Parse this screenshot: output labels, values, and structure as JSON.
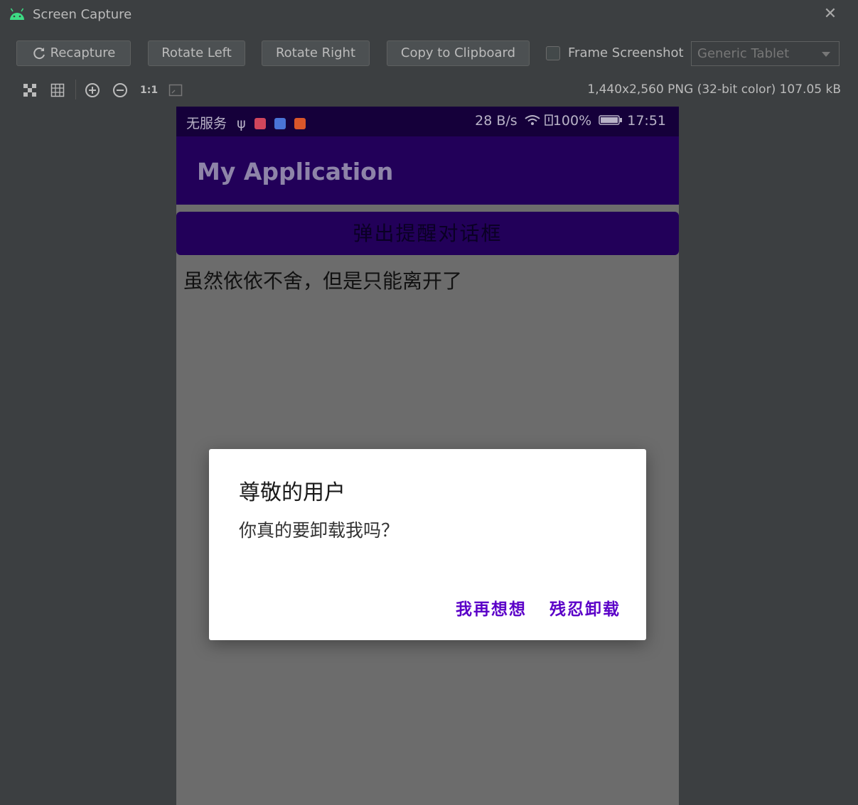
{
  "window": {
    "title": "Screen Capture"
  },
  "toolbar": {
    "recapture": "Recapture",
    "rotate_left": "Rotate Left",
    "rotate_right": "Rotate Right",
    "copy": "Copy to Clipboard",
    "frame_label": "Frame Screenshot",
    "frame_checked": false,
    "device": "Generic Tablet"
  },
  "tools": {
    "actual_size": "1:1"
  },
  "info": "1,440x2,560 PNG (32-bit color) 107.05 kB",
  "phone": {
    "status_left": "无服务",
    "speed": "28 B/s",
    "battery": "100%",
    "time": "17:51",
    "app_title": "My Application",
    "main_button": "弹出提醒对话框",
    "body_text": "虽然依依不舍，但是只能离开了",
    "dialog": {
      "title": "尊敬的用户",
      "message": "你真的要卸载我吗？",
      "negative": "我再想想",
      "positive": "残忍卸载"
    }
  },
  "colors": {
    "accent": "#5b00c8",
    "appbar": "#220059",
    "statusbar": "#15003a"
  }
}
